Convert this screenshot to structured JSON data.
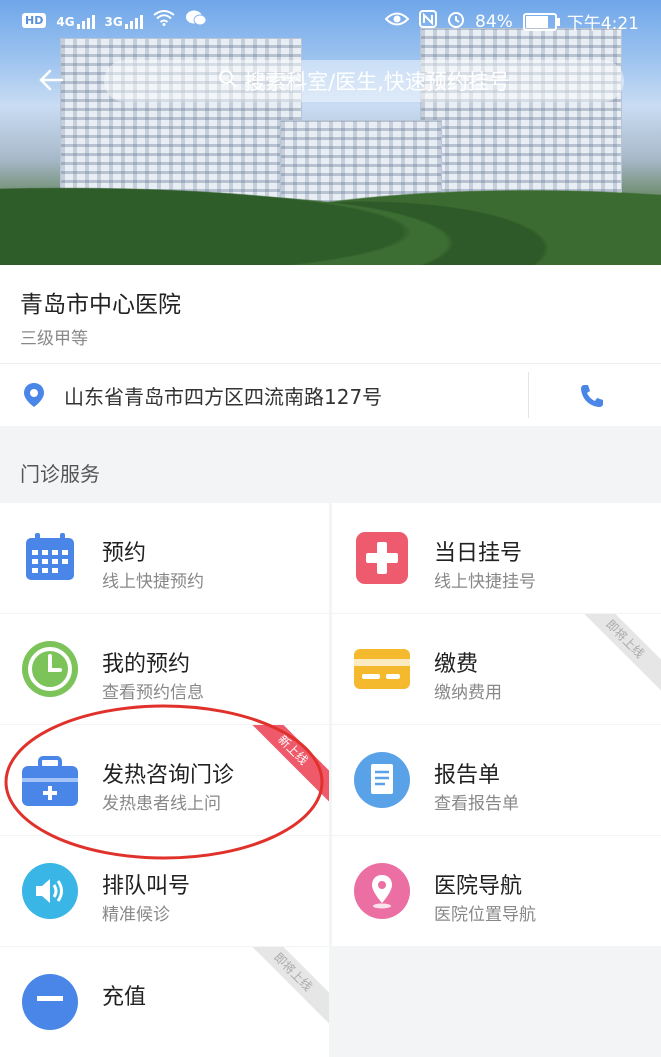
{
  "status_bar": {
    "left": {
      "hd": "HD",
      "net1": "4G",
      "net2": "3G"
    },
    "right": {
      "battery": "84%",
      "time": "下午4:21",
      "battery_level": 0.84
    }
  },
  "header": {
    "back_icon": "back-arrow-icon",
    "search_placeholder": "搜索科室/医生,快速预约挂号"
  },
  "hospital": {
    "name": "青岛市中心医院",
    "level": "三级甲等",
    "address": "山东省青岛市四方区四流南路127号"
  },
  "section": {
    "title": "门诊服务"
  },
  "services": [
    {
      "title": "预约",
      "subtitle": "线上快捷预约",
      "icon": "calendar-icon",
      "color": "#4a86e8"
    },
    {
      "title": "当日挂号",
      "subtitle": "线上快捷挂号",
      "icon": "plus-cross-icon",
      "color": "#ee5b6e"
    },
    {
      "title": "我的预约",
      "subtitle": "查看预约信息",
      "icon": "clock-icon",
      "color": "#7cc35a"
    },
    {
      "title": "缴费",
      "subtitle": "缴纳费用",
      "icon": "payment-card-icon",
      "color": "#f5b92e",
      "ribbon": "即将上线"
    },
    {
      "title": "发热咨询门诊",
      "subtitle": "发热患者线上问",
      "icon": "medical-kit-icon",
      "color": "#4a86e8",
      "ribbon": "新上线"
    },
    {
      "title": "报告单",
      "subtitle": "查看报告单",
      "icon": "report-document-icon",
      "color": "#5aa2e8"
    },
    {
      "title": "排队叫号",
      "subtitle": "精准候诊",
      "icon": "speaker-icon",
      "color": "#3ab6e6"
    },
    {
      "title": "医院导航",
      "subtitle": "医院位置导航",
      "icon": "location-pin-icon",
      "color": "#ec6fa3"
    },
    {
      "title": "充值",
      "subtitle": "",
      "icon": "recharge-card-icon",
      "color": "#4a86e8",
      "ribbon": "即将上线"
    }
  ],
  "hero_image": {
    "description_visible": "青岛市中心医院"
  }
}
